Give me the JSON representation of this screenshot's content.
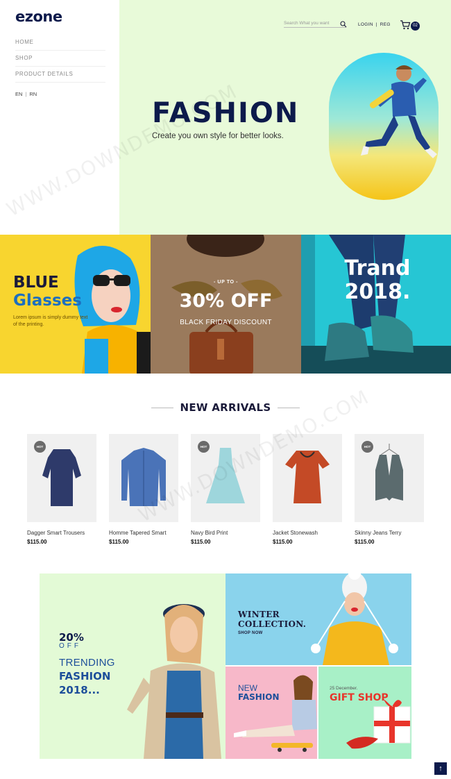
{
  "logo": {
    "text": "ezone"
  },
  "nav": {
    "items": [
      "HOME",
      "SHOP",
      "PRODUCT DETAILS"
    ]
  },
  "lang": {
    "en": "EN",
    "other": "RN",
    "sep": "|"
  },
  "header": {
    "search_placeholder": "Search What you want",
    "login": "LOGIN",
    "reg": "REG",
    "sep": "|",
    "cart_count": "02"
  },
  "hero": {
    "title": "FASHION",
    "subtitle": "Create you own style for better looks."
  },
  "banners": {
    "blue": {
      "title_line1": "BLUE",
      "title_line2": "Glasses",
      "text": "Lorem ipsum is simply dummy text of the printing."
    },
    "friday": {
      "upto": "- UP TO -",
      "off": "30% OFF",
      "sub": "BLACK FRIDAY DISCOUNT"
    },
    "trend": {
      "title": "Trand 2018."
    }
  },
  "new_arrivals": {
    "title": "NEW ARRIVALS",
    "products": [
      {
        "name": "Dagger Smart Trousers",
        "price": "$115.00",
        "badge": "HOT",
        "color": "#2e3a6a"
      },
      {
        "name": "Homme Tapered Smart",
        "price": "$115.00",
        "badge": "",
        "color": "#4a73b8"
      },
      {
        "name": "Navy Bird Print",
        "price": "$115.00",
        "badge": "HOT",
        "color": "#9ed6dc"
      },
      {
        "name": "Jacket Stonewash",
        "price": "$115.00",
        "badge": "",
        "color": "#c44a26"
      },
      {
        "name": "Skinny Jeans Terry",
        "price": "$115.00",
        "badge": "HOT",
        "color": "#5b6b6e"
      }
    ]
  },
  "promo": {
    "main": {
      "pct": "20%",
      "off": "OFF",
      "line1": "TRENDING",
      "line2": "FASHION",
      "line3": "2018..."
    },
    "winter": {
      "title_line1": "WINTER",
      "title_line2": "COLLECTION.",
      "cta": "SHOP NOW"
    },
    "new": {
      "line1": "NEW",
      "line2": "FASHION"
    },
    "gift": {
      "date": "25 December.",
      "title": "GIFT SHOP"
    }
  },
  "scroll_top": {
    "label": "↑"
  },
  "watermark": {
    "text": "WWW.DOWNDEMO.COM"
  }
}
